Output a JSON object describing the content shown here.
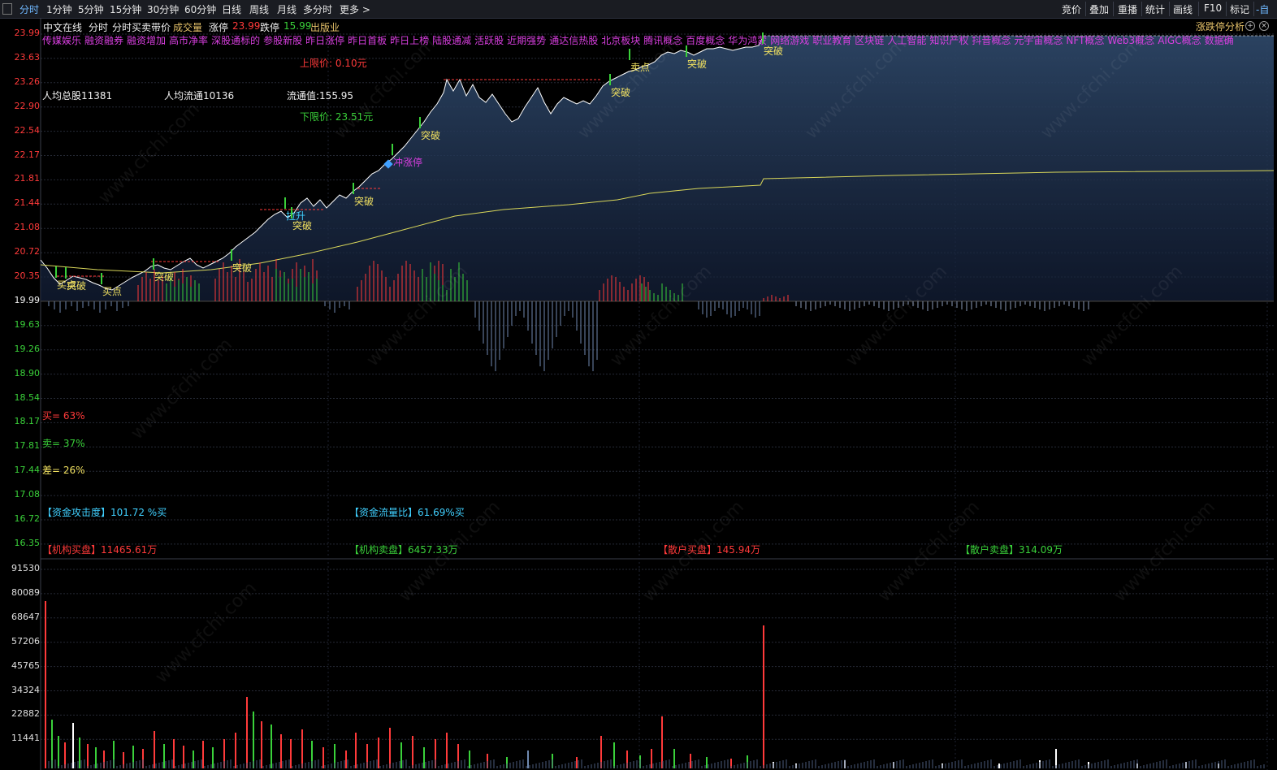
{
  "topbar": {
    "periods": [
      "分时",
      "1分钟",
      "5分钟",
      "15分钟",
      "30分钟",
      "60分钟",
      "日线",
      "周线",
      "月线",
      "多分时",
      "更多 >"
    ],
    "right_items": [
      "竞价",
      "叠加",
      "重播",
      "统计",
      "画线",
      "F10",
      "标记",
      "-自"
    ]
  },
  "header": {
    "stock_name": "中文在线",
    "view": "分时",
    "indicator": "分时买卖带价",
    "volume_label": "成交量",
    "limit_up_label": "涨停",
    "limit_up_value": "23.99",
    "limit_down_label": "跌停",
    "limit_down_value": "15.99",
    "industry": "出版业",
    "analysis_button": "涨跌停分析"
  },
  "concepts": [
    "传媒娱乐",
    "融资融券",
    "融资增加",
    "高市净率",
    "深股通标的",
    "参股新股",
    "昨日涨停",
    "昨日首板",
    "昨日上榜",
    "陆股通减",
    "活跃股",
    "近期强势",
    "通达信热股",
    "北京板块",
    "腾讯概念",
    "百度概念",
    "华为鸿蒙",
    "网络游戏",
    "职业教育",
    "区块链",
    "人工智能",
    "知识产权",
    "抖音概念",
    "元宇宙概念",
    "NFT概念",
    "Web3概念",
    "AIGC概念",
    "数据确"
  ],
  "info": {
    "avg_total_shares": "人均总股11381",
    "avg_float_shares": "人均流通10136",
    "float_value": "流通值:155.95",
    "upper_limit": "上限价: 0.10元",
    "lower_limit": "下限价: 23.51元"
  },
  "y_axis_price": [
    "23.99",
    "23.63",
    "23.26",
    "22.90",
    "22.54",
    "22.17",
    "21.81",
    "21.44",
    "21.08",
    "20.72",
    "20.35",
    "19.99",
    "19.63",
    "19.26",
    "18.90",
    "18.54",
    "18.17",
    "17.81",
    "17.44",
    "17.08",
    "16.72",
    "16.35"
  ],
  "y_axis_volume": [
    "91530",
    "80089",
    "68647",
    "57206",
    "45765",
    "34324",
    "22882",
    "11441"
  ],
  "stats": {
    "buy": "买= 63%",
    "sell": "卖= 37%",
    "diff": "差= 26%",
    "attack": "【资金攻击度】101.72 %买",
    "flow_ratio": "【资金流量比】61.69%买",
    "inst_buy": "【机构买盘】11465.61万",
    "inst_sell": "【机构卖盘】6457.33万",
    "retail_buy": "【散户买盘】145.94万",
    "retail_sell": "【散户卖盘】314.09万"
  },
  "signals": {
    "breakout": "突破",
    "buy_point": "买点",
    "sell_point": "卖点",
    "pull_up": "拉升",
    "hit_limit": "冲涨停"
  },
  "watermark": "www.cfchi.com",
  "colors": {
    "up": "#ff3a3a",
    "down": "#3ad13a",
    "price_line": "#ffffff",
    "avg_line": "#d8d65a",
    "label_yellow": "#f0e060",
    "concept": "#d93fe0",
    "cyan": "#40d0ff"
  }
}
